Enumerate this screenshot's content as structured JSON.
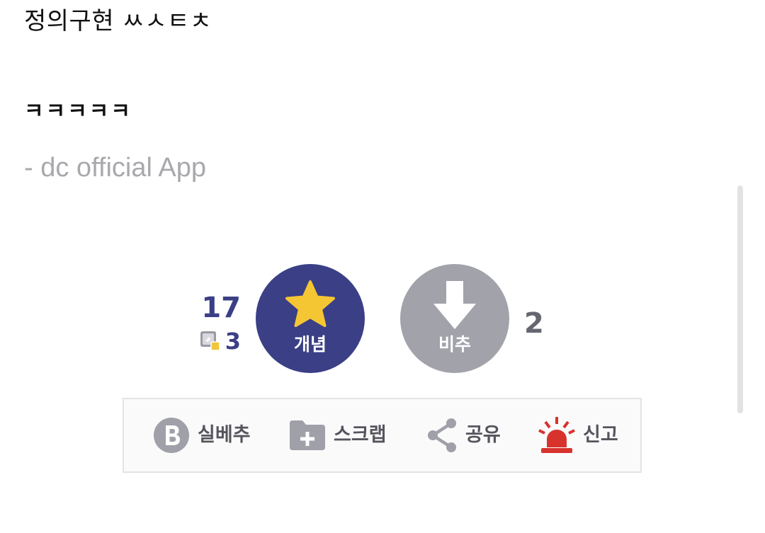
{
  "post": {
    "line1": "정의구현 ㅆㅅㅌㅊ",
    "line2": "ㅋㅋㅋㅋㅋ",
    "signature": "- dc official App"
  },
  "votes": {
    "up_count": "17",
    "fix_count": "3",
    "up_label": "개념",
    "down_label": "비추",
    "down_count": "2"
  },
  "actions": [
    {
      "label": "실베추",
      "icon": "b-icon"
    },
    {
      "label": "스크랩",
      "icon": "folder-plus-icon"
    },
    {
      "label": "공유",
      "icon": "share-icon"
    },
    {
      "label": "신고",
      "icon": "siren-icon"
    }
  ],
  "colors": {
    "up_button": "#3b3f86",
    "down_button": "#a2a2ab",
    "star": "#f5c633",
    "siren": "#d8322c",
    "signature_text": "#a8a8ad"
  }
}
